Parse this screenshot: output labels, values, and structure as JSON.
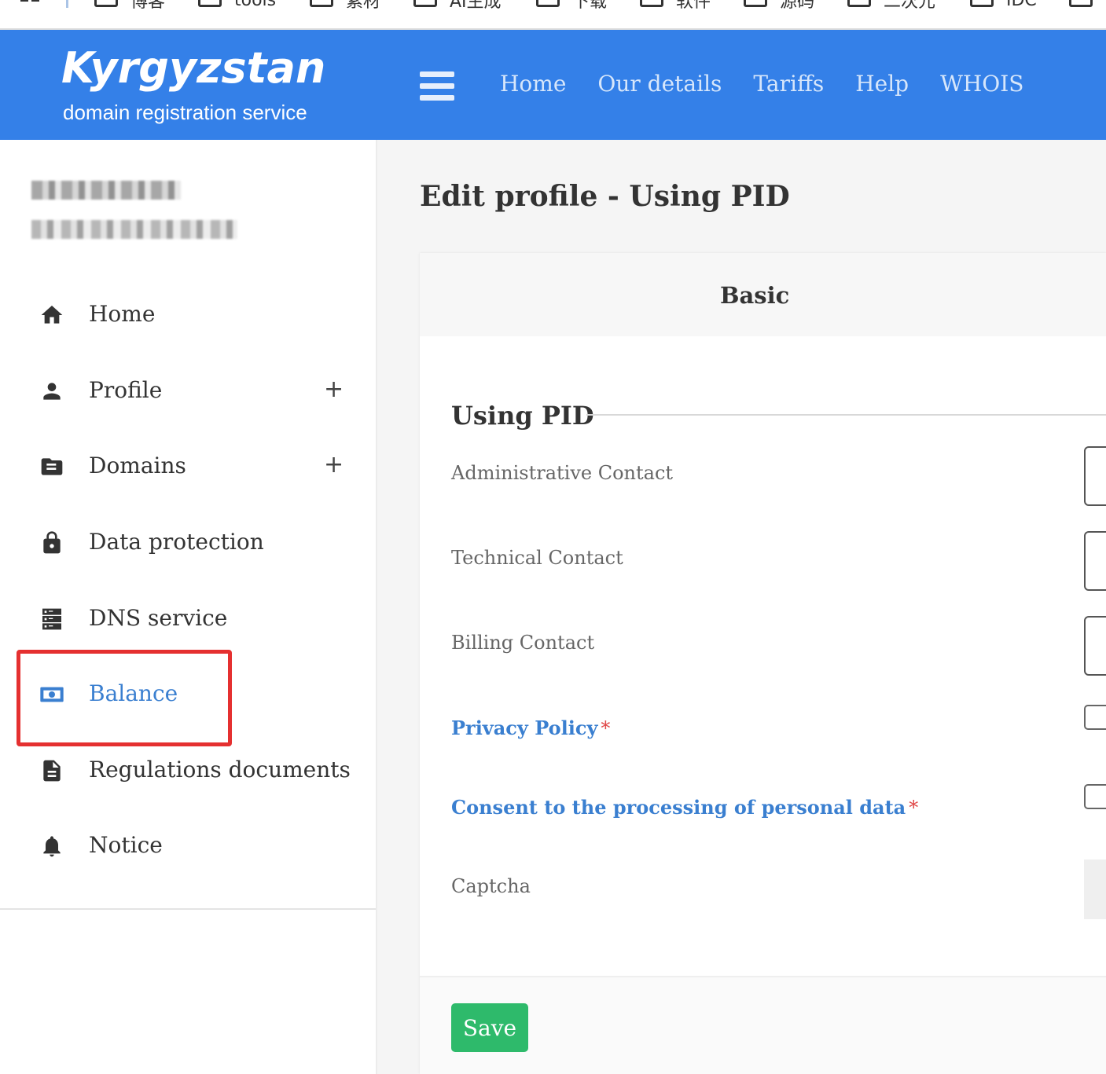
{
  "bookmarks_bar": {
    "items": [
      {
        "label": "博客"
      },
      {
        "label": "tools"
      },
      {
        "label": "素材"
      },
      {
        "label": "AI生成"
      },
      {
        "label": "下载"
      },
      {
        "label": "软件"
      },
      {
        "label": "源码"
      },
      {
        "label": "二次元"
      },
      {
        "label": "IDC"
      }
    ]
  },
  "header": {
    "logo_title": "Kyrgyzstan",
    "logo_subtitle": "domain registration service",
    "nav": [
      "Home",
      "Our details",
      "Tariffs",
      "Help",
      "WHOIS"
    ],
    "bg_color": "#3480e8"
  },
  "sidebar": {
    "user_name_redacted": "",
    "user_email_redacted": "",
    "items": [
      {
        "label": "Home",
        "icon": "home-icon",
        "expandable": false,
        "active": false
      },
      {
        "label": "Profile",
        "icon": "person-icon",
        "expandable": true,
        "active": false
      },
      {
        "label": "Domains",
        "icon": "folder-icon",
        "expandable": true,
        "active": false
      },
      {
        "label": "Data protection",
        "icon": "lock-icon",
        "expandable": false,
        "active": false
      },
      {
        "label": "DNS service",
        "icon": "dns-icon",
        "expandable": false,
        "active": false
      },
      {
        "label": "Balance",
        "icon": "money-icon",
        "expandable": false,
        "active": true
      },
      {
        "label": "Regulations documents",
        "icon": "document-icon",
        "expandable": false,
        "active": false
      },
      {
        "label": "Notice",
        "icon": "bell-icon",
        "expandable": false,
        "active": false
      }
    ],
    "expand_symbol": "+",
    "active_color": "#3a7fd0",
    "highlight_color": "#e53030"
  },
  "main": {
    "page_title": "Edit profile - Using PID",
    "tabs": [
      {
        "label": "Basic"
      }
    ],
    "section_title": "Using PID",
    "fields": {
      "admin_contact": "Administrative Contact",
      "tech_contact": "Technical Contact",
      "billing_contact": "Billing Contact",
      "privacy_policy": "Privacy Policy",
      "consent": "Consent to the processing of personal data",
      "captcha": "Captcha"
    },
    "required_marker": "*",
    "save_label": "Save",
    "save_color": "#2eba6b"
  }
}
